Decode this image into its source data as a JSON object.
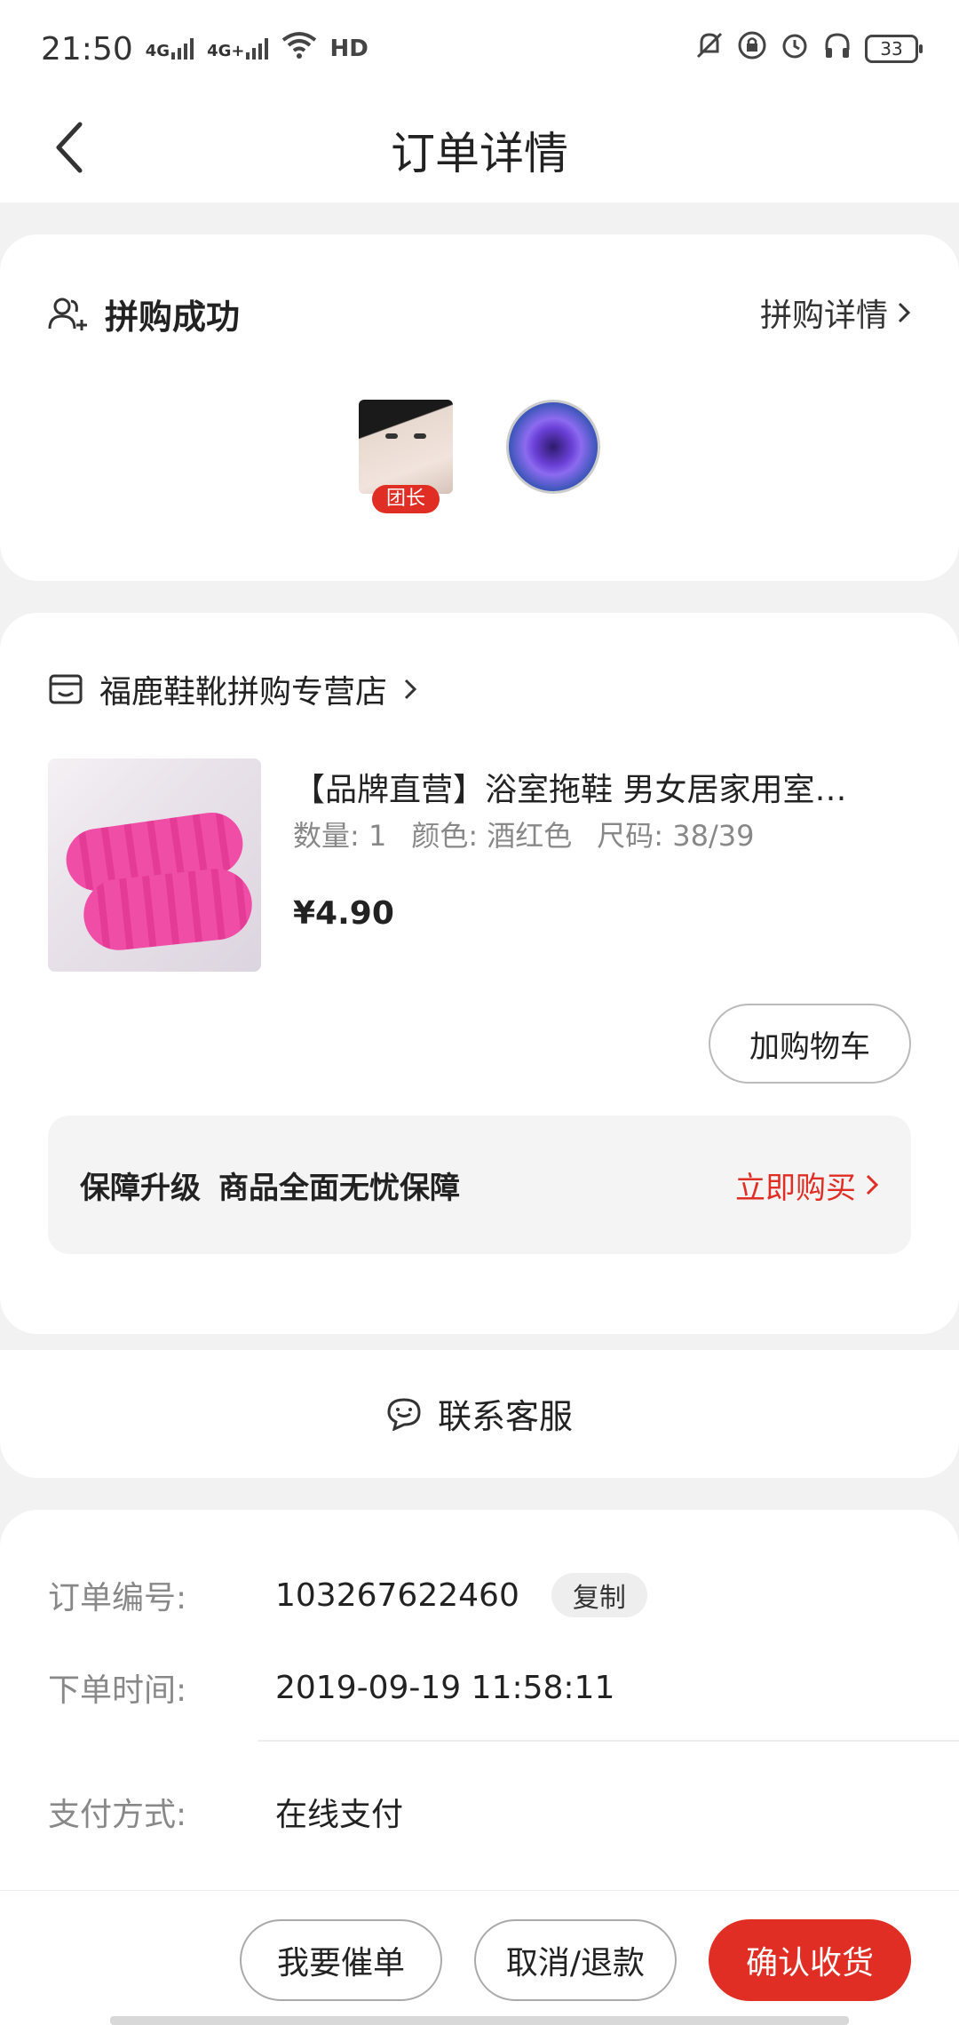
{
  "status_bar": {
    "time": "21:50",
    "network_1": "4G",
    "network_2": "4G+",
    "hd": "HD",
    "battery": "33"
  },
  "nav": {
    "title": "订单详情"
  },
  "group": {
    "title": "拼购成功",
    "detail_link": "拼购详情",
    "leader_badge": "团长"
  },
  "shop": {
    "name": "福鹿鞋靴拼购专营店"
  },
  "product": {
    "title": "【品牌直营】浴室拖鞋 男女居家用室…",
    "quantity": "数量: 1",
    "color": "颜色: 酒红色",
    "size": "尺码: 38/39",
    "price": "¥4.90",
    "add_to_cart": "加购物车"
  },
  "guarantee": {
    "title": "保障升级",
    "subtitle": "商品全面无忧保障",
    "buy_link": "立即购买"
  },
  "contact": {
    "label": "联系客服"
  },
  "order_info": {
    "order_no_label": "订单编号:",
    "order_no": "103267622460",
    "copy": "复制",
    "time_label": "下单时间:",
    "time": "2019-09-19 11:58:11",
    "pay_label": "支付方式:",
    "pay": "在线支付"
  },
  "bottom_bar": {
    "urge": "我要催单",
    "cancel": "取消/退款",
    "confirm": "确认收货"
  },
  "colors": {
    "accent": "#e02e24",
    "background": "#f2f2f2"
  }
}
